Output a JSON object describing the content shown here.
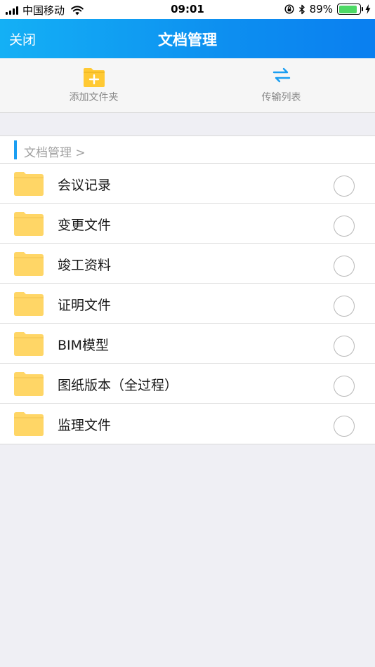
{
  "status_bar": {
    "carrier": "中国移动",
    "time": "09:01",
    "battery_percent": "89%",
    "battery_level": 0.89
  },
  "nav": {
    "close_label": "关闭",
    "title": "文档管理"
  },
  "toolbar": {
    "add_folder_label": "添加文件夹",
    "transfer_list_label": "传输列表",
    "add_folder_icon": "folder-add-icon",
    "transfer_icon": "transfer-arrows-icon",
    "folder_color": "#ffc933",
    "transfer_color": "#1a9ef2"
  },
  "breadcrumb": {
    "path": "文档管理 >"
  },
  "files": [
    {
      "name": "会议记录",
      "icon": "folder-icon",
      "selected": false
    },
    {
      "name": "变更文件",
      "icon": "folder-icon",
      "selected": false
    },
    {
      "name": "竣工资料",
      "icon": "folder-icon",
      "selected": false
    },
    {
      "name": "证明文件",
      "icon": "folder-icon",
      "selected": false
    },
    {
      "name": "BIM模型",
      "icon": "folder-icon",
      "selected": false
    },
    {
      "name": "图纸版本（全过程）",
      "icon": "folder-icon",
      "selected": false
    },
    {
      "name": "监理文件",
      "icon": "folder-icon",
      "selected": false
    }
  ],
  "colors": {
    "nav_gradient_start": "#14b0f5",
    "nav_gradient_end": "#0a7ff0",
    "accent": "#1a9ef2",
    "folder": "#ffd666",
    "background": "#efeff4"
  }
}
